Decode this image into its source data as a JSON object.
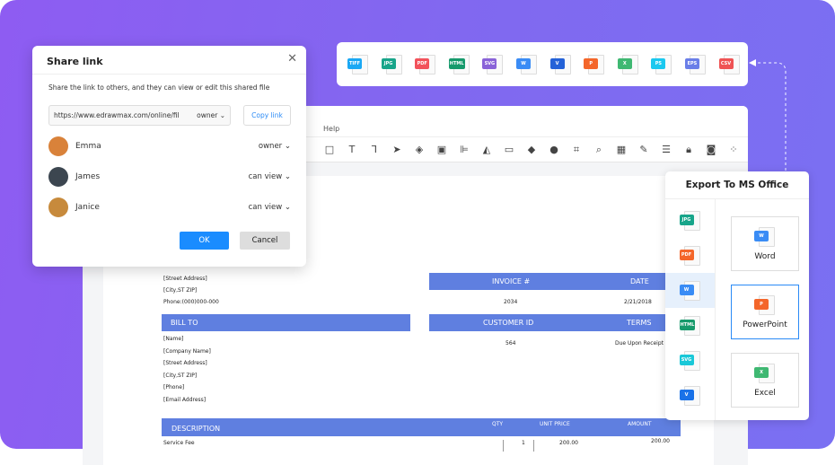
{
  "formats": [
    {
      "label": "TIFF",
      "color": "#1aa8f4"
    },
    {
      "label": "JPG",
      "color": "#18a58a"
    },
    {
      "label": "PDF",
      "color": "#f2525b"
    },
    {
      "label": "HTML",
      "color": "#179a6c"
    },
    {
      "label": "SVG",
      "color": "#8a63d8"
    },
    {
      "label": "W",
      "color": "#3a8cf5"
    },
    {
      "label": "V",
      "color": "#2462d8"
    },
    {
      "label": "P",
      "color": "#f4662a"
    },
    {
      "label": "X",
      "color": "#3fb872"
    },
    {
      "label": "PS",
      "color": "#1ac8ef"
    },
    {
      "label": "EPS",
      "color": "#6a7ee8"
    },
    {
      "label": "CSV",
      "color": "#ef5354"
    }
  ],
  "editor": {
    "menu_help": "Help"
  },
  "invoice": {
    "from": [
      "[Street Address]",
      "[City,ST ZIP]",
      "Phone:(000)000-000"
    ],
    "invoice_no_label": "INVOICE #",
    "date_label": "DATE",
    "invoice_no": "2034",
    "date": "2/21/2018",
    "bill_to": "BILL TO",
    "customer_id_label": "CUSTOMER ID",
    "terms_label": "TERMS",
    "customer_id": "564",
    "terms": "Due Upon Receipt",
    "bill": [
      "[Name]",
      "[Company Name]",
      "[Street Address]",
      "[City,ST ZIP]",
      "[Phone]",
      "[Email Address]"
    ],
    "cols": {
      "description": "DESCRIPTION",
      "qty": "QTY",
      "unit_price": "UNIT PRICE",
      "amount": "AMOUNT"
    },
    "row": {
      "description": "Service Fee",
      "qty": "1",
      "unit_price": "200.00",
      "amount": "200.00"
    }
  },
  "share": {
    "title": "Share link",
    "description": "Share the link to others, and they can view or edit this shared file",
    "url": "https://www.edrawmax.com/online/fil",
    "url_role": "owner",
    "copy": "Copy link",
    "users": [
      {
        "name": "Emma",
        "role": "owner",
        "color": "#d9823a"
      },
      {
        "name": "James",
        "role": "can view",
        "color": "#3c4650"
      },
      {
        "name": "Janice",
        "role": "can view",
        "color": "#c78a3c"
      }
    ],
    "ok": "OK",
    "cancel": "Cancel"
  },
  "export": {
    "title": "Export To MS Office",
    "side": [
      {
        "label": "JPG",
        "color": "#18a58a"
      },
      {
        "label": "PDF",
        "color": "#f4662a"
      },
      {
        "label": "W",
        "color": "#3a8cf5"
      },
      {
        "label": "HTML",
        "color": "#179a6c"
      },
      {
        "label": "SVG",
        "color": "#1ac8d8"
      },
      {
        "label": "V",
        "color": "#1a72e8"
      }
    ],
    "cards": [
      {
        "label": "Word",
        "tag": "W",
        "color": "#3a8cf5"
      },
      {
        "label": "PowerPoint",
        "tag": "P",
        "color": "#f4662a"
      },
      {
        "label": "Excel",
        "tag": "X",
        "color": "#3fb872"
      }
    ]
  }
}
